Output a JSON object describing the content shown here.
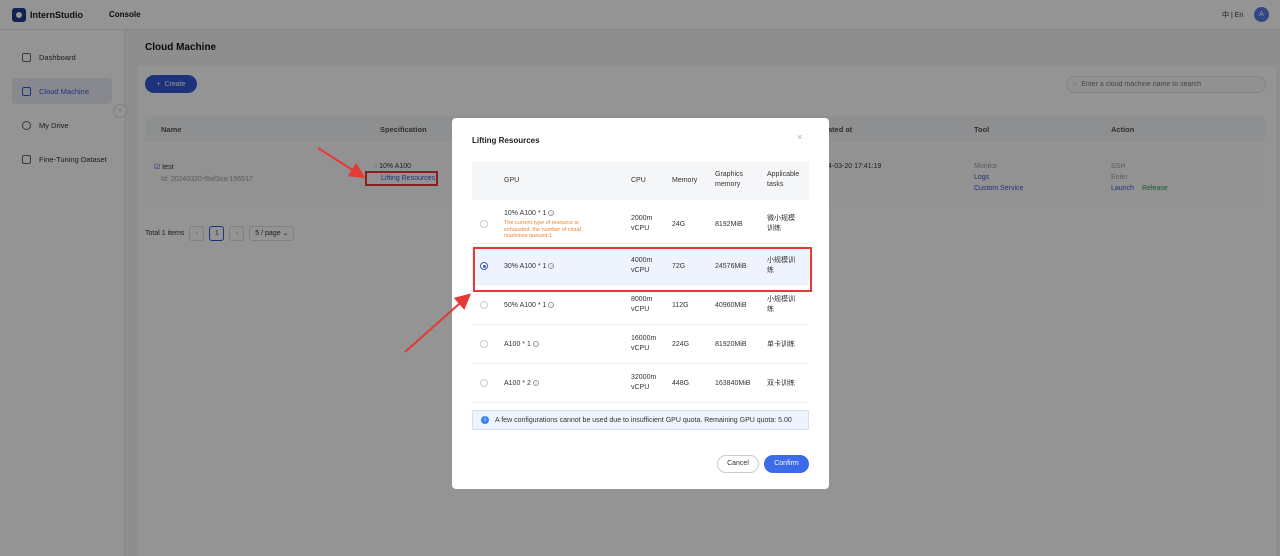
{
  "app": {
    "name": "InternStudio",
    "console_label": "Console",
    "lang_switch": "中 | En",
    "avatar_letter": "A"
  },
  "sidebar": {
    "items": [
      {
        "label": "Dashboard",
        "active": false
      },
      {
        "label": "Cloud Machine",
        "active": true
      },
      {
        "label": "My Drive",
        "active": false
      },
      {
        "label": "Fine-Tuning Dataset",
        "active": false
      }
    ]
  },
  "main": {
    "title": "Cloud Machine",
    "create_label": "Create",
    "search_placeholder": "Enter a cloud machine name to search",
    "columns": {
      "name": "Name",
      "spec": "Specification",
      "created": "ated at",
      "tool": "Tool",
      "action": "Action"
    },
    "row": {
      "name": "test",
      "id": "Id: 20240320-f9af3ca-156517",
      "spec": "10% A100",
      "lift_link": "Lifting Resources",
      "created": "4-03-20 17:41:19",
      "tools": {
        "monitor": "Monitor",
        "logs": "Logs",
        "custom": "Custom Service"
      },
      "actions": {
        "ssh": "SSH",
        "enter": "Enter",
        "launch": "Launch",
        "release": "Release"
      }
    },
    "pagination": {
      "total": "Total 1 items",
      "current": "1",
      "page_size": "5 / page"
    }
  },
  "modal": {
    "title": "Lifting Resources",
    "headers": {
      "gpu": "GPU",
      "cpu": "CPU",
      "memory": "Memory",
      "graphics_1": "Graphics",
      "graphics_2": "memory",
      "tasks_1": "Applicable",
      "tasks_2": "tasks"
    },
    "rows": [
      {
        "gpu": "10% A100 * 1",
        "cpu_1": "2000m",
        "cpu_2": "vCPU",
        "memory": "24G",
        "graphics": "8192MiB",
        "task_1": "微小规模",
        "task_2": "训练",
        "warning": "The current type of resource is exhausted, the number of cloud machines queued:1",
        "selected": false
      },
      {
        "gpu": "30% A100 * 1",
        "cpu_1": "4000m",
        "cpu_2": "vCPU",
        "memory": "72G",
        "graphics": "24576MiB",
        "task_1": "小规模训",
        "task_2": "练",
        "warning": "",
        "selected": true
      },
      {
        "gpu": "50% A100 * 1",
        "cpu_1": "8000m",
        "cpu_2": "vCPU",
        "memory": "112G",
        "graphics": "40960MiB",
        "task_1": "小规模训",
        "task_2": "练",
        "warning": "",
        "selected": false
      },
      {
        "gpu": "A100 * 1",
        "cpu_1": "16000m",
        "cpu_2": "vCPU",
        "memory": "224G",
        "graphics": "81920MiB",
        "task_1": "单卡训练",
        "task_2": "",
        "warning": "",
        "selected": false
      },
      {
        "gpu": "A100 * 2",
        "cpu_1": "32000m",
        "cpu_2": "vCPU",
        "memory": "448G",
        "graphics": "163840MiB",
        "task_1": "双卡训练",
        "task_2": "",
        "warning": "",
        "selected": false
      }
    ],
    "info": "A few configurations cannot be used due to insufficient GPU quota. Remaining GPU quota: 5.00",
    "cancel_label": "Cancel",
    "confirm_label": "Confirm"
  },
  "colors": {
    "accent": "#3557d4",
    "annotation": "#e53935",
    "warning": "#f0822b"
  }
}
